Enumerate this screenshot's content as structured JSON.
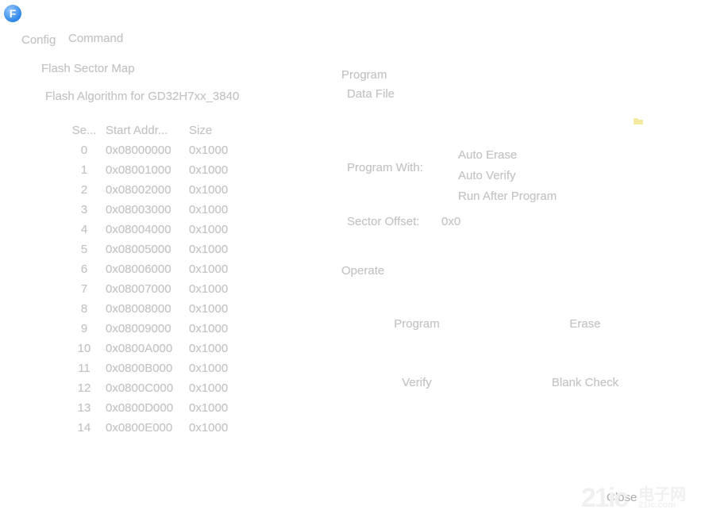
{
  "app": {
    "logo_letter": "F"
  },
  "menu": [
    {
      "label": "Config"
    },
    {
      "label": "Command"
    }
  ],
  "sector_map": {
    "title": "Flash Sector Map",
    "algorithm": "Flash Algorithm for GD32H7xx_3840",
    "columns": [
      "Se...",
      "Start Addr...",
      "Size"
    ],
    "rows": [
      [
        "0",
        "0x08000000",
        "0x1000"
      ],
      [
        "1",
        "0x08001000",
        "0x1000"
      ],
      [
        "2",
        "0x08002000",
        "0x1000"
      ],
      [
        "3",
        "0x08003000",
        "0x1000"
      ],
      [
        "4",
        "0x08004000",
        "0x1000"
      ],
      [
        "5",
        "0x08005000",
        "0x1000"
      ],
      [
        "6",
        "0x08006000",
        "0x1000"
      ],
      [
        "7",
        "0x08007000",
        "0x1000"
      ],
      [
        "8",
        "0x08008000",
        "0x1000"
      ],
      [
        "9",
        "0x08009000",
        "0x1000"
      ],
      [
        "10",
        "0x0800A000",
        "0x1000"
      ],
      [
        "11",
        "0x0800B000",
        "0x1000"
      ],
      [
        "12",
        "0x0800C000",
        "0x1000"
      ],
      [
        "13",
        "0x0800D000",
        "0x1000"
      ],
      [
        "14",
        "0x0800E000",
        "0x1000"
      ]
    ]
  },
  "program": {
    "title": "Program",
    "data_file_label": "Data File",
    "program_with_label": "Program With:",
    "options": [
      "Auto Erase",
      "Auto Verify",
      "Run After Program"
    ],
    "sector_offset_label": "Sector Offset:",
    "sector_offset_value": "0x0"
  },
  "operate": {
    "title": "Operate",
    "buttons": {
      "program": "Program",
      "erase": "Erase",
      "verify": "Verify",
      "blank_check": "Blank Check"
    }
  },
  "footer": {
    "close_label": "Close"
  },
  "watermark": {
    "number": "21ic",
    "cn": "电子网",
    "url": "21ic.com"
  },
  "colors": {
    "text": "#c4c4c4",
    "logo": "#2f86e8"
  }
}
